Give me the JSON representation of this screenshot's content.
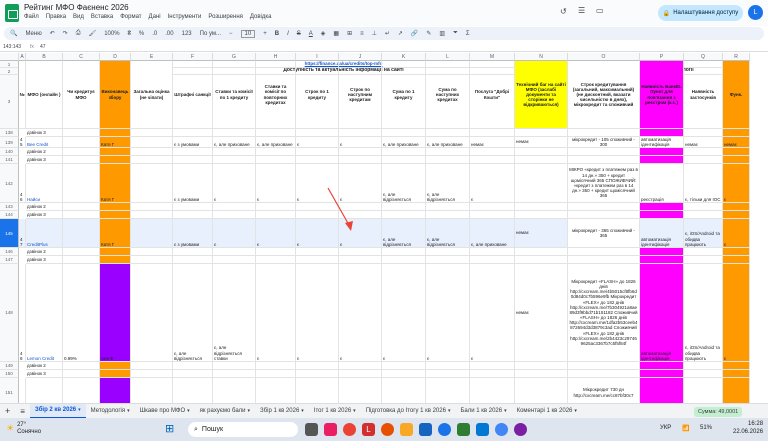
{
  "window": {
    "title": "Рейтинг МФО Фаєненс 2026",
    "sharing": "Налаштування доступу",
    "user_initial": "L"
  },
  "menu": [
    "Файл",
    "Правка",
    "Вид",
    "Вставка",
    "Формат",
    "Дані",
    "Інструменти",
    "Розширення",
    "Довідка"
  ],
  "toolbar": {
    "search": "Меню",
    "zoom": "100%",
    "currency": "₴",
    "percent": "%",
    "dec1": ".0",
    "dec2": ".00",
    "numfmt": "123",
    "font": "По ум...",
    "size": "10"
  },
  "formula": {
    "ref": "143:143",
    "fx": "fx",
    "value": "47"
  },
  "columns": [
    "A",
    "B",
    "C",
    "D",
    "E",
    "F",
    "G",
    "H",
    "I",
    "J",
    "K",
    "L",
    "M",
    "N",
    "O",
    "P",
    "Q",
    "R"
  ],
  "link_top": "https://finance.ua/ua/credits/top-mfo",
  "section_header": "Доступність та актуальність інформації на сайті",
  "section_tech": "Технології",
  "section_num": "2",
  "headers": {
    "no": "№",
    "mfo": "МФО (онлайн )",
    "credit": "Чи кредитує МФО",
    "resp": "Виконавець збору",
    "total": "Загальна оцінка (не чіпати)",
    "fines": "Штрафні санкції",
    "rates": "Ставки та комісії по 1 кредиту",
    "rates2": "Ставки та комісії по повторних кредитах",
    "term1": "Строк по 1 кредиту",
    "term2": "Строк по наступним кредитам",
    "sum1": "Сума по 1 кредиту",
    "sum2": "Сума по наступних кредитах",
    "dobryi": "Послуга \"Добрі Кошти\"",
    "bug": "Технічний баг на сайті МФО (заслабі документи та сторінки не відкриваються)",
    "srok": "Строк кредитування (загальний, максимальний) (не дисконтний, вказати чисельністю в днях), мікрокредит та споживчий",
    "nbu": "Наявність БанкІD. Пункт для пов'язання з реєстром (к.с.)",
    "apps": "Наявність застосунків",
    "fun": "Функ."
  },
  "rows": [
    {
      "n": "138",
      "label": "дзвінок 3"
    },
    {
      "n": "139",
      "num": "45",
      "mfo": "Bee Credit",
      "resp": "Катя Г",
      "f": "є з умовами",
      "g": "є, але приховане",
      "h": "є, але приховане",
      "i": "є",
      "j": "є",
      "k": "є, але приховане",
      "l": "є, але приховане",
      "m": "немає",
      "n2": "немає",
      "o": "мікрокредит - 105 споживчий - 300",
      "p": "автоматизація ідентифікація",
      "q": "немає",
      "r": "немає"
    },
    {
      "n": "140",
      "label": "дзвінок 2"
    },
    {
      "n": "141",
      "label": "дзвінок 3"
    },
    {
      "n": "142",
      "num": "46",
      "mfo": "Найси",
      "resp": "Катя Г",
      "f": "є з умовами",
      "g": "є",
      "h": "є",
      "i": "є",
      "j": "є",
      "k": "є, але відрізняється",
      "l": "є, але відрізняється",
      "m": "є",
      "o": "МІКРО «кредит з платежем раз в 14 дн.» 350 + кредит щомісячний 365 СПОЖИВЧИЙ: «кредит з платежем раз в 14 дн.» 350 + кредит щомісячний 365",
      "p": "реєстрація",
      "q": "є, тільки для ІОС",
      "r": "є"
    },
    {
      "n": "143",
      "label": "дзвінок 2"
    },
    {
      "n": "144",
      "label": "дзвінок 3"
    },
    {
      "n": "145",
      "num": "47",
      "mfo": "CreditPlus",
      "resp": "Катя Г",
      "f": "є з умовами",
      "g": "є",
      "h": "є",
      "i": "є",
      "j": "є",
      "k": "є, але відрізняється",
      "l": "є, але відрізняється",
      "m": "є, але приховане",
      "n2": "немає",
      "o": "мікрокредит - 365 споживчий - 365",
      "p": "автоматизація ідентифікація",
      "q": "є, iOS/Android та обидва працюють",
      "r": "є"
    },
    {
      "n": "146",
      "label": "дзвінок 2"
    },
    {
      "n": "147",
      "label": "дзвінок 3"
    },
    {
      "n": "148",
      "num": "48",
      "mfo": "Lemon Credit",
      "cred": "0.99%",
      "resp": "Аня Ф",
      "f": "є, але відрізняється",
      "g": "є, але відрізняється ставки",
      "h": "є",
      "i": "є",
      "j": "є",
      "k": "є",
      "l": "є",
      "m": "є",
      "n2": "немає",
      "o": "Мікрокредит «FLASH» до 1826 днів http://cxcream.me/4b5015cf8fb6d0d84d0c7b596e9fb Мікрокредит «FLEX» до 182 днів http://cxcream.me/7b304921a8ae89d3f9bbd71b151182 Споживчий «FLASH» до 1826 днів http://cxcream.me/1dfa2b53ceeb4872694d3d3879c3ad Споживчий «FLEX» до 182 днів http://cxcream.me/2b4423c297469625ac3367b7c5f5f84f",
      "p": "автоматизація ідентифікація",
      "q": "є, iOS/Android та обидва працюють",
      "r": "є"
    },
    {
      "n": "149",
      "label": "дзвінок 2"
    },
    {
      "n": "150",
      "label": "дзвінок 3"
    },
    {
      "n": "151",
      "o": "Мікрокредит 730 дн http://cxcream.me/cc87bf30c7"
    }
  ],
  "dd_value": "немає",
  "tabs": [
    "Збір 2 кв 2026",
    "Методологія",
    "Шкаве про МФО",
    "як рахуємо бали",
    "Збір 1 кв 2026",
    "Ітог 1 кв 2026",
    "Підготовка до Ітогу 1 кв 2026",
    "Бали 1 кв 2026",
    "Коментарі 1 кв 2026"
  ],
  "sum_label": "Сумма: 49,0001",
  "taskbar": {
    "weather_temp": "27°",
    "weather_text": "Сонячно",
    "search": "Пошук",
    "lang": "УКР",
    "battery": "51%",
    "time": "16:28",
    "date": "22.06.2026"
  },
  "colors": {
    "orange": "#ff9900",
    "magenta": "#ff00ff",
    "purple": "#9900ff",
    "yellow": "#ffff00",
    "blue_sel": "#e8f0fe",
    "arrow": "#ea4335"
  }
}
